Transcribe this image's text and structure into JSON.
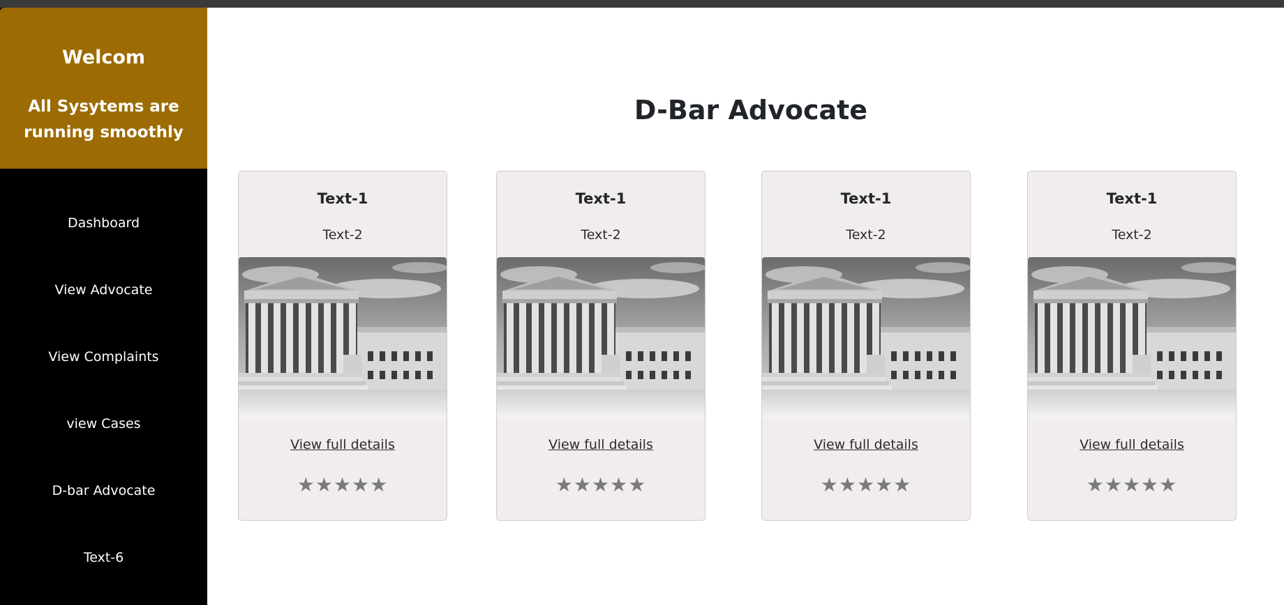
{
  "sidebar": {
    "welcome": "Welcom",
    "status": "All Sysytems are running smoothly",
    "nav": [
      "Dashboard",
      "View Advocate",
      "View Complaints",
      "view Cases",
      "D-bar Advocate",
      "Text-6"
    ]
  },
  "main": {
    "title": "D-Bar Advocate",
    "cards": [
      {
        "title": "Text-1",
        "subtitle": "Text-2",
        "link": "View full details",
        "rating": 5
      },
      {
        "title": "Text-1",
        "subtitle": "Text-2",
        "link": "View full details",
        "rating": 5
      },
      {
        "title": "Text-1",
        "subtitle": "Text-2",
        "link": "View full details",
        "rating": 5
      },
      {
        "title": "Text-1",
        "subtitle": "Text-2",
        "link": "View full details",
        "rating": 5
      }
    ]
  },
  "icons": {
    "rating_star": "star-icon",
    "card_image": "courthouse-image"
  },
  "colors": {
    "sidebar_header": "#9c6b03",
    "sidebar": "#000000",
    "card_bg": "#f2eded",
    "star": "#7a7a7a"
  }
}
